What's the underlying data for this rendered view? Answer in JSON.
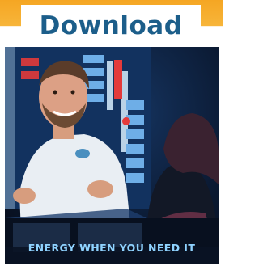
{
  "download_button": {
    "label": "Download"
  },
  "hero_image": {
    "caption": "ENERGY WHEN YOU NEED IT"
  },
  "colors": {
    "banner_orange": "#f5a623",
    "button_text_blue": "#1c5e8a",
    "caption_blue": "#8fd3ff"
  }
}
